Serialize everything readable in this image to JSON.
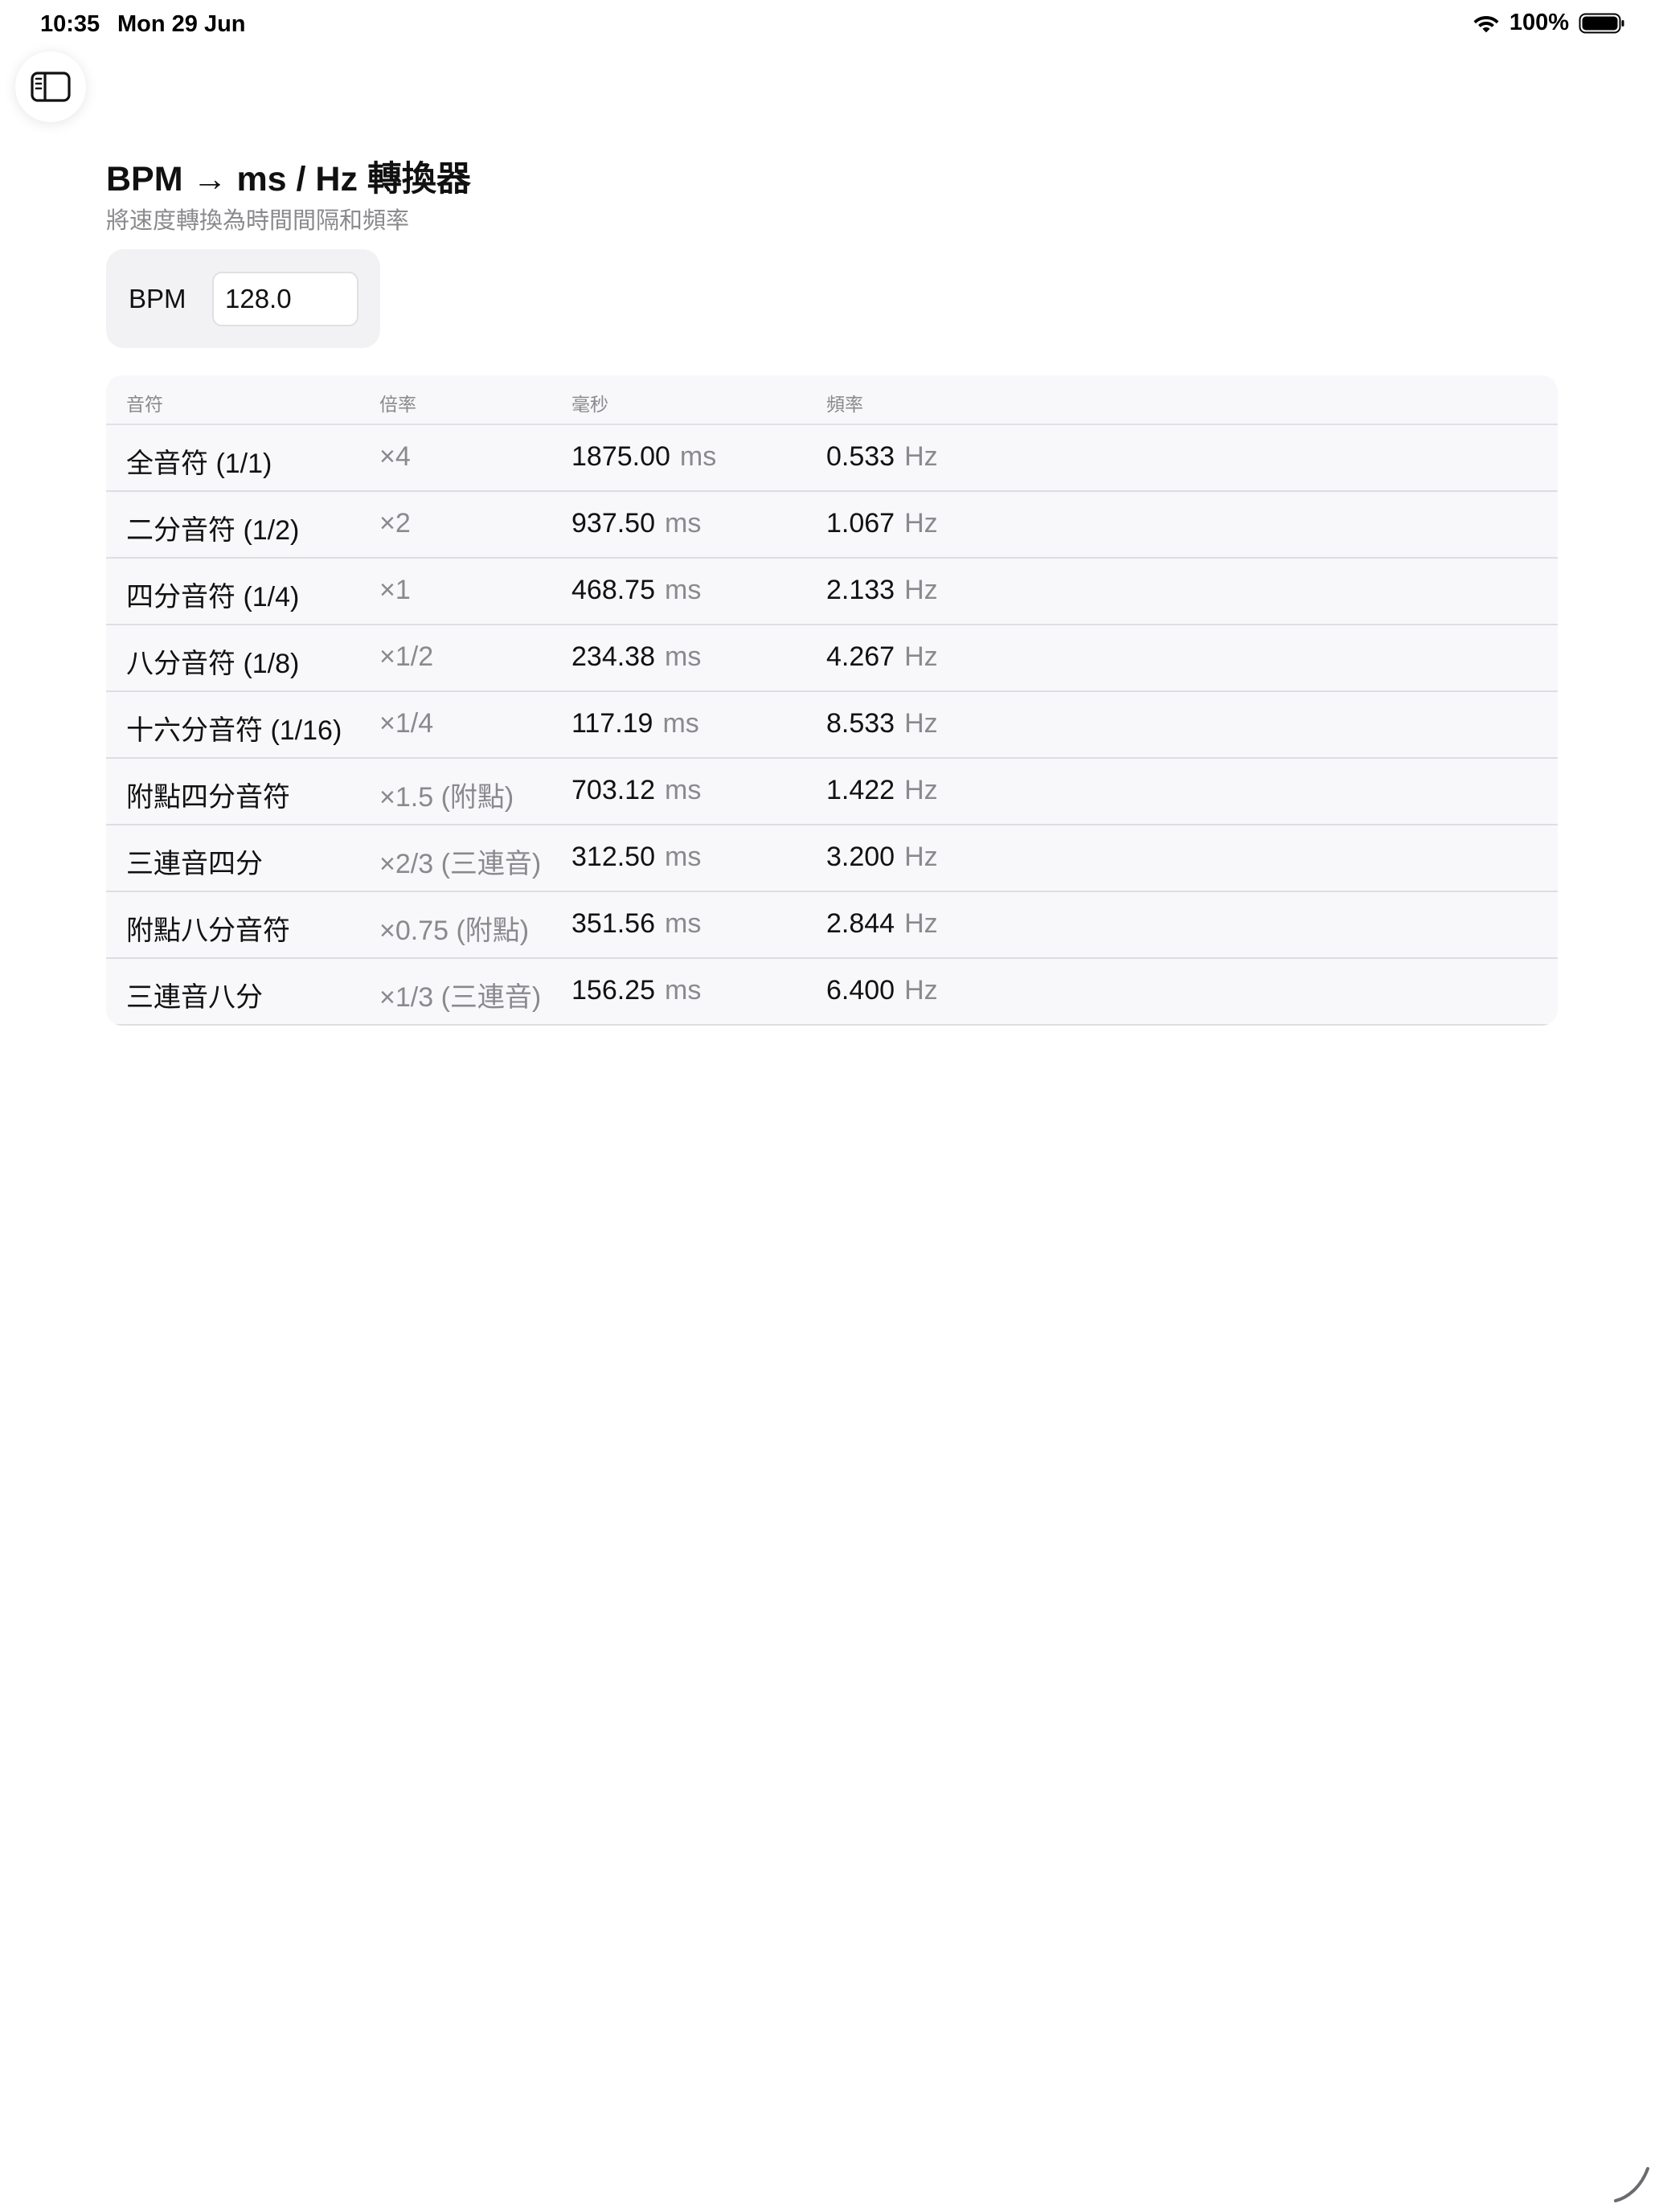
{
  "status_bar": {
    "time": "10:35",
    "date": "Mon 29 Jun",
    "battery": "100%"
  },
  "header": {
    "title": "BPM → ms / Hz 轉換器",
    "subtitle": "將速度轉換為時間間隔和頻率"
  },
  "bpm_input": {
    "label": "BPM",
    "value": "128.0"
  },
  "table": {
    "headers": {
      "note": "音符",
      "multiplier": "倍率",
      "ms": "毫秒",
      "hz": "頻率"
    },
    "ms_unit": "ms",
    "hz_unit": "Hz",
    "rows": [
      {
        "note": "全音符 (1/1)",
        "multiplier": "×4",
        "ms": "1875.00",
        "hz": "0.533"
      },
      {
        "note": "二分音符 (1/2)",
        "multiplier": "×2",
        "ms": "937.50",
        "hz": "1.067"
      },
      {
        "note": "四分音符 (1/4)",
        "multiplier": "×1",
        "ms": "468.75",
        "hz": "2.133"
      },
      {
        "note": "八分音符 (1/8)",
        "multiplier": "×1/2",
        "ms": "234.38",
        "hz": "4.267"
      },
      {
        "note": "十六分音符 (1/16)",
        "multiplier": "×1/4",
        "ms": "117.19",
        "hz": "8.533"
      },
      {
        "note": "附點四分音符",
        "multiplier": "×1.5 (附點)",
        "ms": "703.12",
        "hz": "1.422"
      },
      {
        "note": "三連音四分",
        "multiplier": "×2/3 (三連音)",
        "ms": "312.50",
        "hz": "3.200"
      },
      {
        "note": "附點八分音符",
        "multiplier": "×0.75 (附點)",
        "ms": "351.56",
        "hz": "2.844"
      },
      {
        "note": "三連音八分",
        "multiplier": "×1/3 (三連音)",
        "ms": "156.25",
        "hz": "6.400"
      }
    ]
  }
}
